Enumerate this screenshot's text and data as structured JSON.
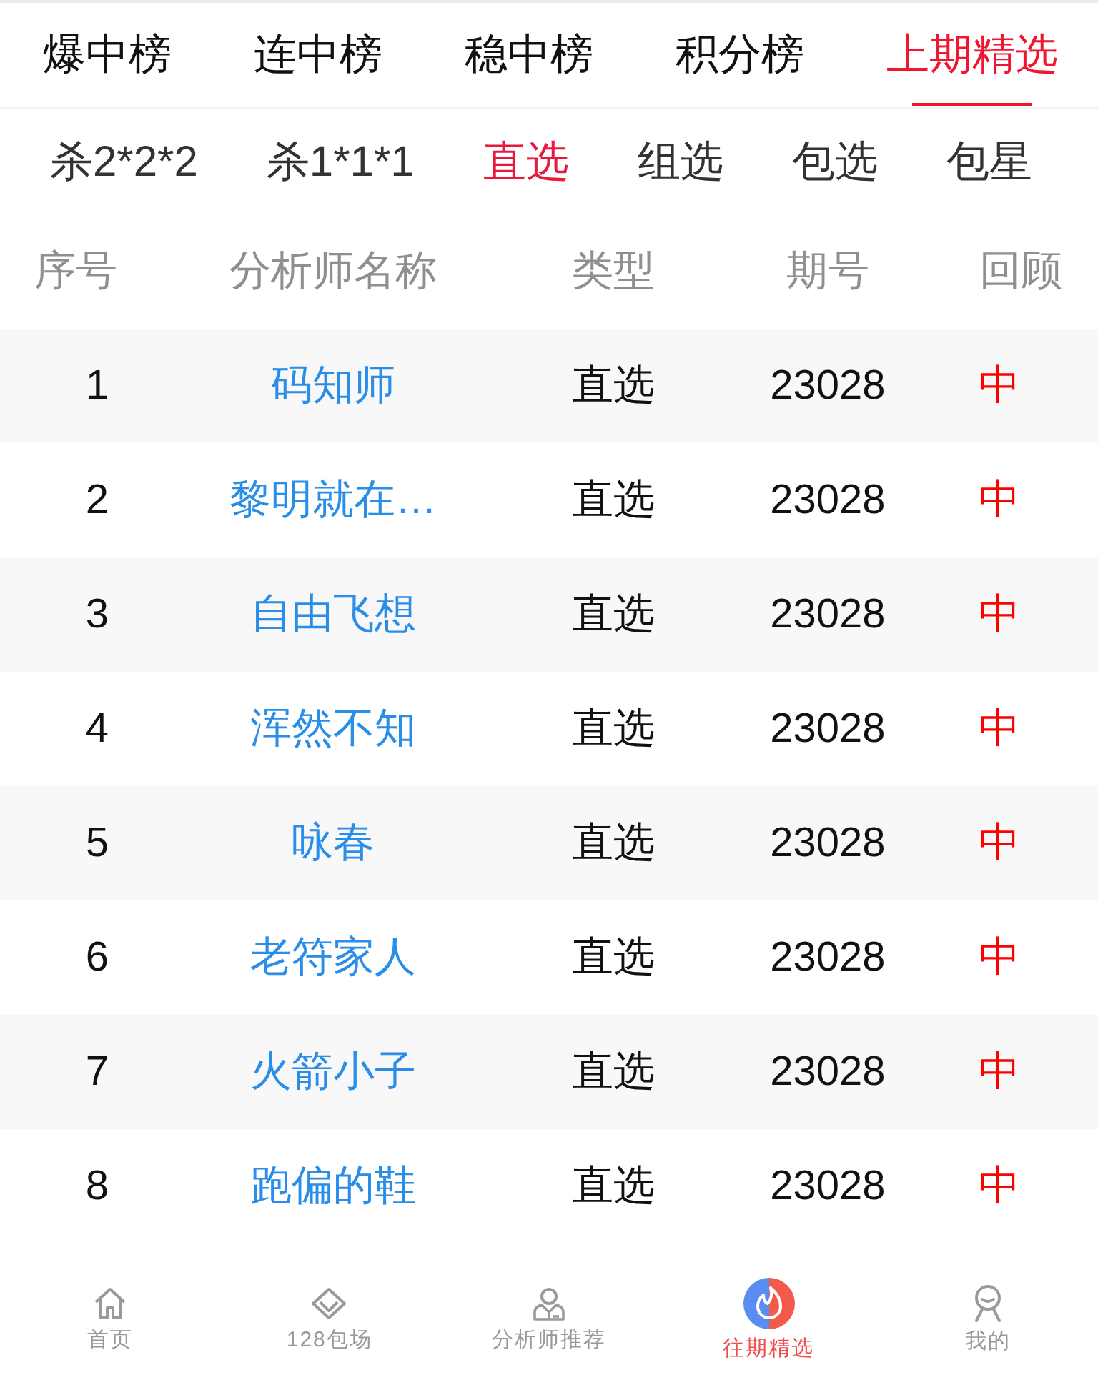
{
  "top_tabs": [
    {
      "label": "爆中榜",
      "selected": false
    },
    {
      "label": "连中榜",
      "selected": false
    },
    {
      "label": "稳中榜",
      "selected": false
    },
    {
      "label": "积分榜",
      "selected": false
    },
    {
      "label": "上期精选",
      "selected": true
    }
  ],
  "sub_tabs": [
    {
      "label": "杀2*2*2",
      "selected": false
    },
    {
      "label": "杀1*1*1",
      "selected": false
    },
    {
      "label": "直选",
      "selected": true
    },
    {
      "label": "组选",
      "selected": false
    },
    {
      "label": "包选",
      "selected": false
    },
    {
      "label": "包星",
      "selected": false
    }
  ],
  "table": {
    "columns": [
      "序号",
      "分析师名称",
      "类型",
      "期号",
      "回顾"
    ],
    "rows": [
      {
        "index": "1",
        "name": "码知师",
        "type": "直选",
        "issue": "23028",
        "review": "中"
      },
      {
        "index": "2",
        "name": "黎明就在…",
        "type": "直选",
        "issue": "23028",
        "review": "中"
      },
      {
        "index": "3",
        "name": "自由飞想",
        "type": "直选",
        "issue": "23028",
        "review": "中"
      },
      {
        "index": "4",
        "name": "浑然不知",
        "type": "直选",
        "issue": "23028",
        "review": "中"
      },
      {
        "index": "5",
        "name": "咏春",
        "type": "直选",
        "issue": "23028",
        "review": "中"
      },
      {
        "index": "6",
        "name": "老符家人",
        "type": "直选",
        "issue": "23028",
        "review": "中"
      },
      {
        "index": "7",
        "name": "火箭小子",
        "type": "直选",
        "issue": "23028",
        "review": "中"
      },
      {
        "index": "8",
        "name": "跑偏的鞋",
        "type": "直选",
        "issue": "23028",
        "review": "中"
      }
    ]
  },
  "bottom_nav": [
    {
      "label": "首页",
      "kind": "home",
      "selected": false
    },
    {
      "label": "128包场",
      "kind": "diamond",
      "selected": false
    },
    {
      "label": "分析师推荐",
      "kind": "analyst",
      "selected": false
    },
    {
      "label": "往期精选",
      "kind": "flame",
      "selected": true
    },
    {
      "label": "我的",
      "kind": "profile",
      "selected": false
    }
  ]
}
